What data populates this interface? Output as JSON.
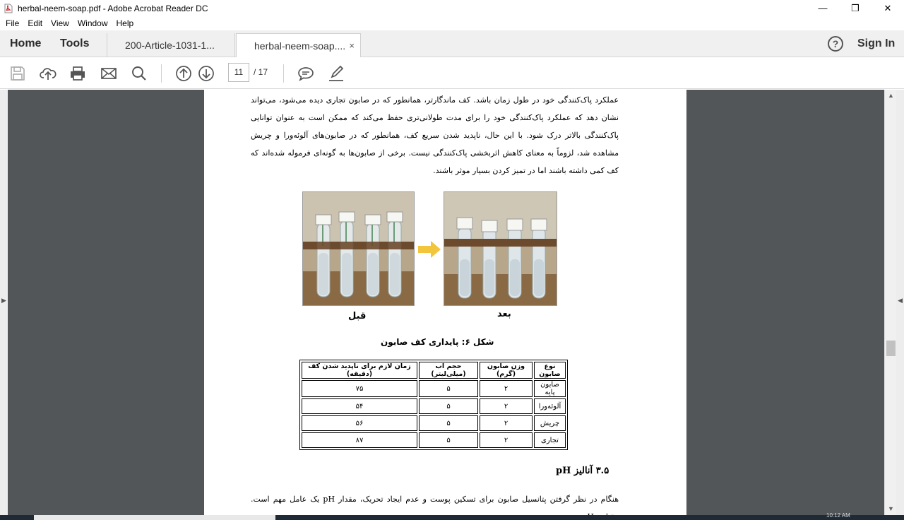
{
  "window": {
    "title": "herbal-neem-soap.pdf - Adobe Acrobat Reader DC",
    "minimize": "—",
    "maximize": "❐",
    "close": "✕"
  },
  "menu": [
    "File",
    "Edit",
    "View",
    "Window",
    "Help"
  ],
  "tabs": {
    "home": "Home",
    "tools": "Tools",
    "doc_tabs": [
      {
        "label": "200-Article-1031-1..."
      },
      {
        "label": "herbal-neem-soap....",
        "close": "×"
      }
    ],
    "help": "?",
    "sign_in": "Sign In"
  },
  "toolbar": {
    "icons": [
      "save-icon",
      "upload-icon",
      "print-icon",
      "email-icon",
      "search-icon",
      "page-up-icon",
      "page-down-icon",
      "comment-icon",
      "sign-pen-icon"
    ],
    "current_page": "11",
    "total_pages": "/  17"
  },
  "document": {
    "paragraph1": "عملکرد پاک‌کنندگی خود در طول زمان باشد. کف ماندگارتر، همانطور که در صابون تجاری دیده می‌شود، می‌تواند نشان دهد که عملکرد پاک‌کنندگی خود را برای مدت طولانی‌تری حفظ می‌کند که ممکن است به عنوان توانایی پاک‌کنندگی بالاتر درک شود. با این حال، ناپدید شدن سریع کف، همانطور که در صابون‌های آلوئه‌ورا و چریش مشاهده شد، لزوماً به معنای کاهش اثربخشی پاک‌کنندگی نیست. برخی از صابون‌ها به گونه‌ای فرموله شده‌اند که کف کمی داشته باشند اما در تمیز کردن بسیار موثر باشند.",
    "figure": {
      "label_before": "قبل",
      "label_after": "بعد",
      "caption": "شکل ۶: پایداری کف صابون"
    },
    "table": {
      "headers": [
        "زمان لازم برای ناپدید شدن کف (دقیقه)",
        "حجم آب (میلی‌لیتر)",
        "وزن صابون (گرم)",
        "نوع صابون"
      ],
      "rows": [
        [
          "۷۵",
          "۵",
          "۲",
          "صابون پایه"
        ],
        [
          "۵۴",
          "۵",
          "۲",
          "آلوئه‌ورا"
        ],
        [
          "۵۶",
          "۵",
          "۲",
          "چریش"
        ],
        [
          "۸۷",
          "۵",
          "۲",
          "تجاری"
        ]
      ]
    },
    "section_title": "۳.۵ آنالیز pH",
    "paragraph2": "هنگام در نظر گرفتن پتانسیل صابون برای تسکین پوست و عدم ایجاد تحریک، مقدار pH یک عامل مهم است. مقیاس pH"
  },
  "taskbar": {
    "clock": "10:12 AM"
  }
}
